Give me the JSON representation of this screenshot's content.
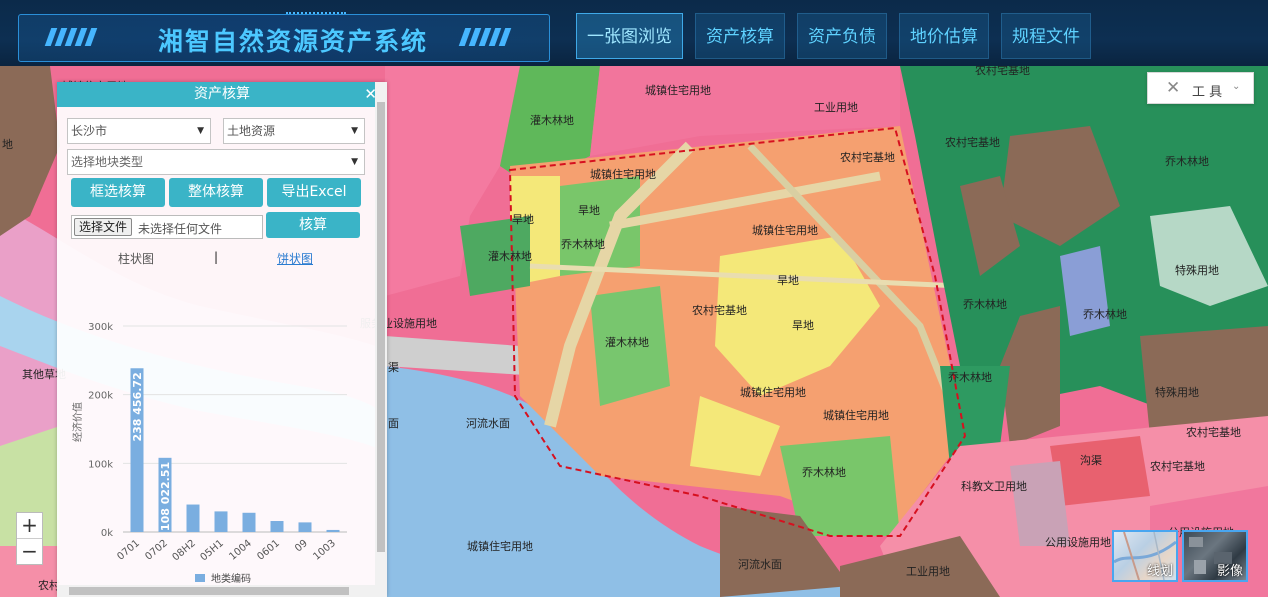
{
  "header": {
    "title": "湘智自然资源资产系统",
    "nav": [
      {
        "label": "一张图浏览",
        "active": true
      },
      {
        "label": "资产核算",
        "active": false
      },
      {
        "label": "资产负债",
        "active": false
      },
      {
        "label": "地价估算",
        "active": false
      },
      {
        "label": "规程文件",
        "active": false
      }
    ]
  },
  "tools": {
    "label": "工 具"
  },
  "panel": {
    "title": "资产核算",
    "city_select": "长沙市",
    "resource_select": "土地资源",
    "landtype_placeholder": "选择地块类型",
    "buttons": {
      "box_calc": "框选核算",
      "whole_calc": "整体核算",
      "export": "导出Excel",
      "calc": "核算"
    },
    "file": {
      "button": "选择文件",
      "text": "未选择任何文件"
    },
    "tabs": {
      "bar": "柱状图",
      "divider": "|",
      "pie": "饼状图"
    }
  },
  "chart_data": {
    "type": "bar",
    "categories": [
      "0701",
      "0702",
      "08H2",
      "05H1",
      "1004",
      "0601",
      "09",
      "1003"
    ],
    "values": [
      238456.72,
      108022.51,
      40000,
      30000,
      28000,
      16000,
      14000,
      3000
    ],
    "value_labels": [
      "238 456.72",
      "108 022.51"
    ],
    "ylim": [
      0,
      300000
    ],
    "yticks": [
      "0k",
      "100k",
      "200k",
      "300k"
    ],
    "ytick_values": [
      0,
      100000,
      200000,
      300000
    ],
    "ylabel": "经济价值",
    "legend": "地类编码",
    "bar_color": "#7aaee0"
  },
  "map": {
    "labels": [
      "城镇住宅用地",
      "灌木林地",
      "工业用地",
      "农村宅基地",
      "农村宅基地",
      "乔木林地",
      "城镇住宅用地",
      "旱地",
      "旱地",
      "乔木林地",
      "灌木林地",
      "城镇住宅用地",
      "特殊用地",
      "乔木林地",
      "乔木林地",
      "旱地",
      "农村宅基地",
      "旱地",
      "服务业设施用地",
      "灌木林地",
      "乔木林地",
      "城镇住宅用地",
      "城镇住宅用地",
      "特殊用地",
      "河流水面",
      "农村宅基地",
      "农村宅基地",
      "沟渠",
      "乔木林地",
      "科教文卫用地",
      "公用设施用地",
      "公用设施用地",
      "城镇住宅用地",
      "河流水面",
      "工业用地",
      "其他草地",
      "农村",
      "地",
      "城镇住宅用地",
      "面",
      "渠",
      "农村宅基地"
    ]
  },
  "basemaps": {
    "line": "线划",
    "image": "影像"
  },
  "zoom": {
    "in": "+",
    "out": "−"
  },
  "colors": {
    "accent": "#3ab4c7",
    "header": "#0d2f52"
  }
}
